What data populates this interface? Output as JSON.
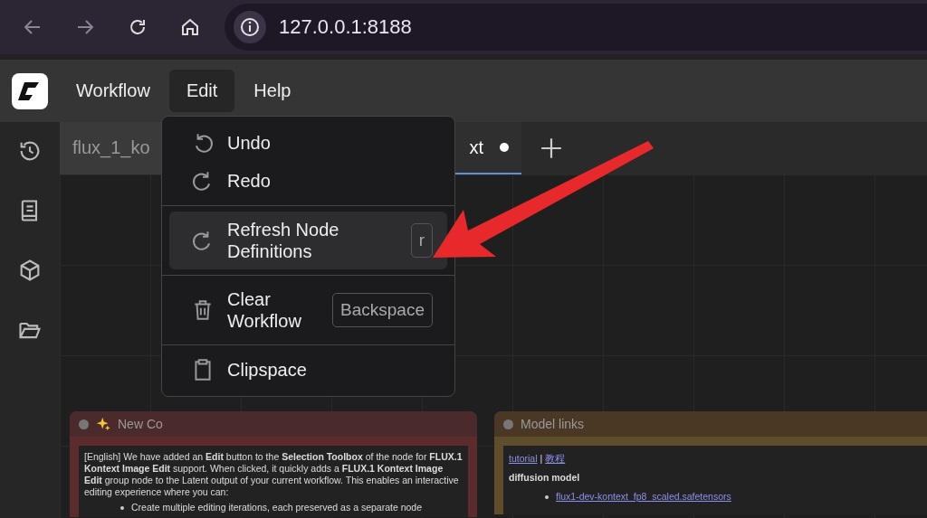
{
  "browser": {
    "url": "127.0.0.1:8188"
  },
  "menubar": {
    "items": [
      {
        "label": "Workflow",
        "selected": false
      },
      {
        "label": "Edit",
        "selected": true
      },
      {
        "label": "Help",
        "selected": false
      }
    ]
  },
  "tabs": [
    {
      "label": "flux_1_ko",
      "selected": false,
      "modified": false
    },
    {
      "label": "xt",
      "selected": true,
      "modified": true
    }
  ],
  "edit_menu": {
    "groups": [
      [
        {
          "kind": "undo",
          "label": "Undo",
          "selected": false
        },
        {
          "kind": "redo",
          "label": "Redo",
          "selected": false
        }
      ],
      [
        {
          "kind": "refresh",
          "label": "Refresh Node Definitions",
          "shortcut": "r",
          "selected": true
        }
      ],
      [
        {
          "kind": "clear",
          "label": "Clear Workflow",
          "shortcut": "Backspace",
          "selected": false
        }
      ],
      [
        {
          "kind": "clipspace",
          "label": "Clipspace",
          "selected": false
        }
      ]
    ]
  },
  "nodes": [
    {
      "title": "New Co",
      "color": "#4a2a2a",
      "paragraphs": [
        "[English] We have added an **Edit** button to the **Selection Toolbox** of the node for **FLUX.1 Kontext Image Edit** support. When clicked, it quickly adds a **FLUX.1 Kontext Image Edit** group node to the Latent output of your current workflow. This enables an interactive editing experience where you can:"
      ],
      "bullets": [
        {
          "text": "Create multiple editing iterations, each preserved as a separate node",
          "link": false
        }
      ]
    },
    {
      "title": "Model links",
      "color": "#4a3824",
      "links": [
        "tutorial",
        "|",
        "教程"
      ],
      "heading": "diffusion model",
      "bullets": [
        {
          "text": "flux1-dev-kontext_fp8_scaled.safetensors",
          "link": true
        }
      ]
    }
  ]
}
